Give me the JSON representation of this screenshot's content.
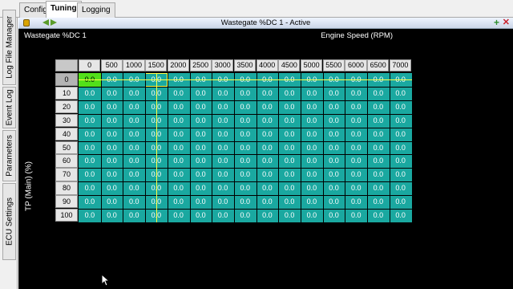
{
  "tabs": [
    "Config",
    "Tuning",
    "Logging"
  ],
  "active_tab": "Tuning",
  "side_tabs": [
    "ECU Settings",
    "Parameters",
    "Event Log",
    "Log File Manager"
  ],
  "window": {
    "title": "Wastegate %DC 1 - Active"
  },
  "table": {
    "name": "Wastegate %DC 1",
    "x_axis_label": "Engine Speed (RPM)",
    "y_axis_label": "TP (Main) (%)",
    "columns": [
      "0",
      "500",
      "1000",
      "1500",
      "2000",
      "2500",
      "3000",
      "3500",
      "4000",
      "4500",
      "5000",
      "5500",
      "6000",
      "6500",
      "7000"
    ],
    "rows": [
      "0",
      "10",
      "20",
      "30",
      "40",
      "50",
      "60",
      "70",
      "80",
      "90",
      "100"
    ],
    "cell_value": "0.0",
    "selected_row": 0,
    "selected_col": 0,
    "highlight_col": 3
  },
  "colors": {
    "cell_bg": "#1aa8a0",
    "selected_cell": "#52e01a",
    "crosshair": "#ffff44"
  }
}
